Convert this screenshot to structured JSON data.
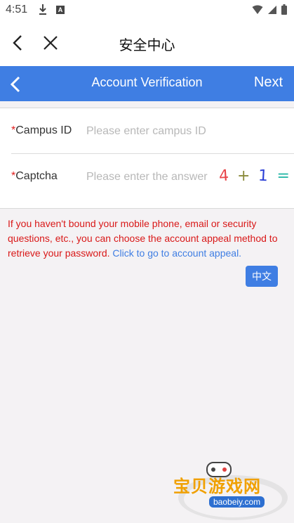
{
  "status_bar": {
    "time": "4:51"
  },
  "app_bar": {
    "title": "安全中心"
  },
  "web_header": {
    "title": "Account Verification",
    "next_label": "Next"
  },
  "form": {
    "campus_id": {
      "required_mark": "*",
      "label": "Campus ID",
      "placeholder": "Please enter campus ID",
      "value": ""
    },
    "captcha": {
      "required_mark": "*",
      "label": "Captcha",
      "placeholder": "Please enter the answer",
      "value": "",
      "challenge": [
        {
          "char": "4",
          "color": "#e8454a"
        },
        {
          "char": "+",
          "color": "#8a8a3a"
        },
        {
          "char": "1",
          "color": "#2b3fd6"
        },
        {
          "char": "=",
          "color": "#2ab8a8"
        }
      ]
    }
  },
  "notice": {
    "text": "If you haven't bound your mobile phone, email or security questions, etc., you can choose the account appeal method to retrieve your password. ",
    "link_text": "Click to go to account appeal."
  },
  "language_button": {
    "label": "中文"
  },
  "watermark": {
    "text": "宝贝游戏网",
    "url": "baobeiy.com"
  },
  "colors": {
    "accent": "#3f7ee3",
    "warning_text": "#d91818",
    "background": "#f4f2f4"
  }
}
